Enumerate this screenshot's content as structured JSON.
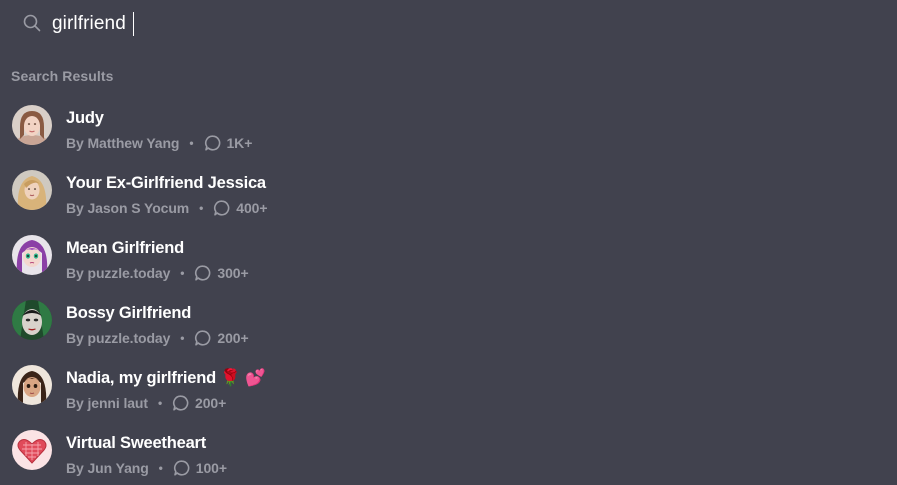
{
  "search": {
    "value": "girlfriend",
    "icon": "search-icon"
  },
  "section_title": "Search Results",
  "colors": {
    "background": "#41424e",
    "text_primary": "#ffffff",
    "text_secondary": "#9a9ba4"
  },
  "results": [
    {
      "title": "Judy",
      "author": "By Matthew Yang",
      "count": "1K+",
      "avatar": "woman-portrait-avatar"
    },
    {
      "title": "Your Ex-Girlfriend Jessica",
      "author": "By Jason S Yocum",
      "count": "400+",
      "avatar": "blonde-woman-avatar"
    },
    {
      "title": "Mean Girlfriend",
      "author": "By puzzle.today",
      "count": "300+",
      "avatar": "purple-hair-anime-avatar"
    },
    {
      "title": "Bossy Girlfriend",
      "author": "By puzzle.today",
      "count": "200+",
      "avatar": "green-face-avatar"
    },
    {
      "title": "Nadia, my girlfriend 🌹 💕",
      "author": "By jenni laut",
      "count": "200+",
      "avatar": "brunette-anime-avatar"
    },
    {
      "title": "Virtual Sweetheart",
      "author": "By Jun Yang",
      "count": "100+",
      "avatar": "heart-avatar"
    }
  ]
}
